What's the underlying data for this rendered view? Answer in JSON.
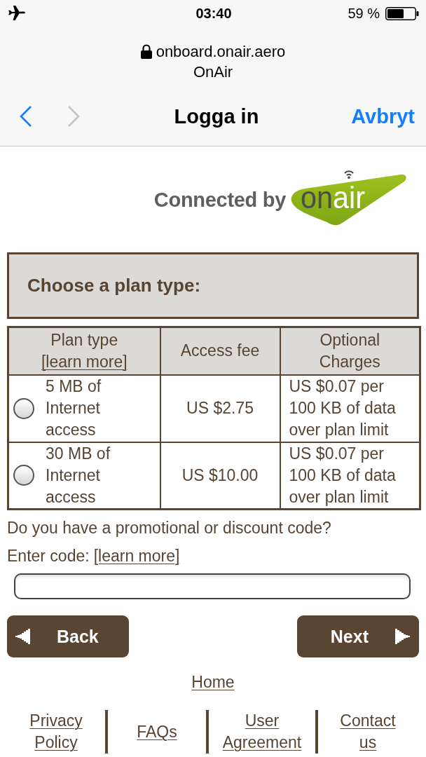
{
  "status_bar": {
    "time": "03:40",
    "battery": "59 %"
  },
  "browser": {
    "domain": "onboard.onair.aero",
    "page_title": "OnAir",
    "back": {
      "disabled": false
    },
    "forward": {
      "disabled": true
    },
    "title": "Logga in",
    "cancel": "Avbryt"
  },
  "logo": {
    "tagline": "Connected by",
    "brand_dark": "on",
    "brand_light": "air"
  },
  "plan_heading": "Choose a plan type:",
  "plan_table": {
    "columns": [
      {
        "label": "Plan type",
        "link": "[learn more]"
      },
      {
        "label": "Access fee"
      },
      {
        "label": "Optional Charges"
      }
    ],
    "rows": [
      {
        "plan": "5 MB of Internet access",
        "fee": "US $2.75",
        "charges": "US $0.07 per 100 KB of data over plan limit",
        "selected": false
      },
      {
        "plan": "30 MB of Internet access",
        "fee": "US $10.00",
        "charges": "US $0.07 per 100 KB of data over plan limit",
        "selected": false
      }
    ]
  },
  "promo": {
    "question": "Do you have a promotional or discount code?",
    "label": "Enter code:",
    "link": "[learn more]"
  },
  "buttons": [
    {
      "label": "Back",
      "kind": "back"
    },
    {
      "label": "Next",
      "kind": "next"
    }
  ],
  "footer": {
    "home": "Home",
    "links": [
      "Privacy Policy",
      "FAQs",
      "User Agreement",
      "Contact us"
    ]
  }
}
